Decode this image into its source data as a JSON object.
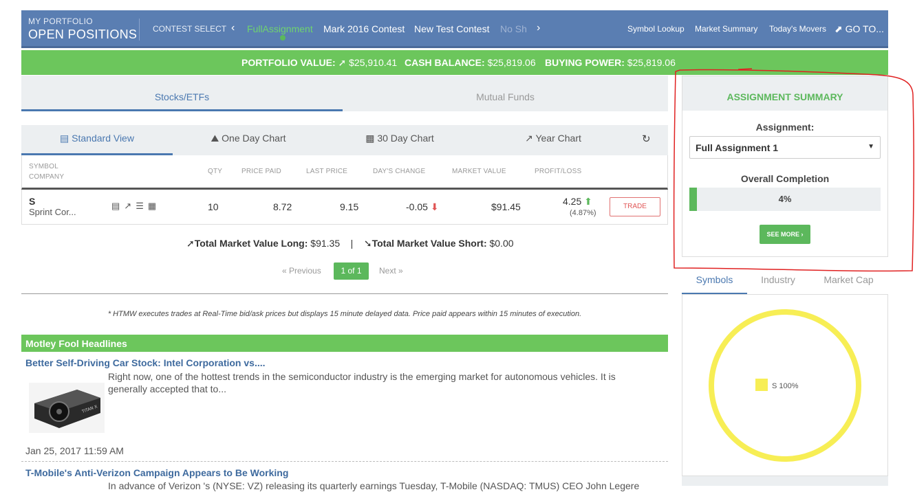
{
  "header": {
    "portfolio_label": "MY PORTFOLIO",
    "page_title": "OPEN POSITIONS",
    "contest_select_label": "CONTEST SELECT",
    "contests": [
      "FullAssignment",
      "Mark 2016 Contest",
      "New Test Contest",
      "No Sh"
    ],
    "active_contest": "FullAssignment",
    "nav": {
      "symbol_lookup": "Symbol Lookup",
      "market_summary": "Market Summary",
      "todays_movers": "Today's Movers",
      "goto": "GO TO..."
    }
  },
  "balances": {
    "portfolio_value_label": "PORTFOLIO VALUE:",
    "portfolio_value": "$25,910.41",
    "cash_balance_label": "CASH BALANCE:",
    "cash_balance": "$25,819.06",
    "buying_power_label": "BUYING POWER:",
    "buying_power": "$25,819.06"
  },
  "asset_tabs": [
    "Stocks/ETFs",
    "Mutual Funds"
  ],
  "view_tabs": [
    "Standard View",
    "One Day Chart",
    "30 Day Chart",
    "Year Chart"
  ],
  "table": {
    "headers": {
      "symbol": "SYMBOL",
      "company": "COMPANY",
      "qty": "QTY",
      "price_paid": "PRICE PAID",
      "last_price": "LAST PRICE",
      "days_change": "DAY'S CHANGE",
      "market_value": "MARKET VALUE",
      "profit_loss": "PROFIT/LOSS"
    },
    "rows": [
      {
        "symbol": "S",
        "company": "Sprint Cor...",
        "qty": "10",
        "price_paid": "8.72",
        "last_price": "9.15",
        "days_change": "-0.05",
        "market_value": "$91.45",
        "profit_loss": "4.25",
        "profit_loss_pct": "(4.87%)",
        "trade_label": "TRADE"
      }
    ]
  },
  "totals": {
    "long_label": "Total Market Value Long:",
    "long_value": "$91.35",
    "separator": "|",
    "short_label": "Total Market Value Short:",
    "short_value": "$0.00"
  },
  "pager": {
    "previous": "« Previous",
    "current": "1 of 1",
    "next": "Next »"
  },
  "disclaimer": "* HTMW executes trades at Real-Time bid/ask prices but displays 15 minute delayed data. Price paid appears within 15 minutes of execution.",
  "headlines": {
    "title": "Motley Fool Headlines",
    "items": [
      {
        "title": "Better Self-Driving Car Stock: Intel Corporation vs....",
        "body": "Right now, one of the hottest trends in the semiconductor industry is the emerging market for autonomous vehicles. It is generally accepted that to...",
        "date": "Jan 25, 2017 11:59 AM",
        "image_text": "TITAN X"
      },
      {
        "title": "T-Mobile's Anti-Verizon Campaign Appears to Be Working",
        "body": "In advance of Verizon 's (NYSE: VZ) releasing its quarterly earnings Tuesday, T-Mobile (NASDAQ: TMUS) CEO John Legere"
      }
    ]
  },
  "assignment": {
    "heading": "ASSIGNMENT SUMMARY",
    "assignment_label": "Assignment:",
    "selected": "Full Assignment 1",
    "completion_label": "Overall Completion",
    "completion_pct": 4,
    "completion_text": "4%",
    "see_more": "SEE MORE"
  },
  "chart_tabs": [
    "Symbols",
    "Industry",
    "Market Cap"
  ],
  "colors": {
    "header_blue": "#5a7eb2",
    "green": "#6cc65c",
    "link_blue": "#4a78b0",
    "annotation_red": "#e02020",
    "donut_yellow": "#f7ee55"
  },
  "chart_data": {
    "type": "pie",
    "categories": [
      "S"
    ],
    "values": [
      100
    ],
    "labels": [
      "S 100%"
    ]
  }
}
